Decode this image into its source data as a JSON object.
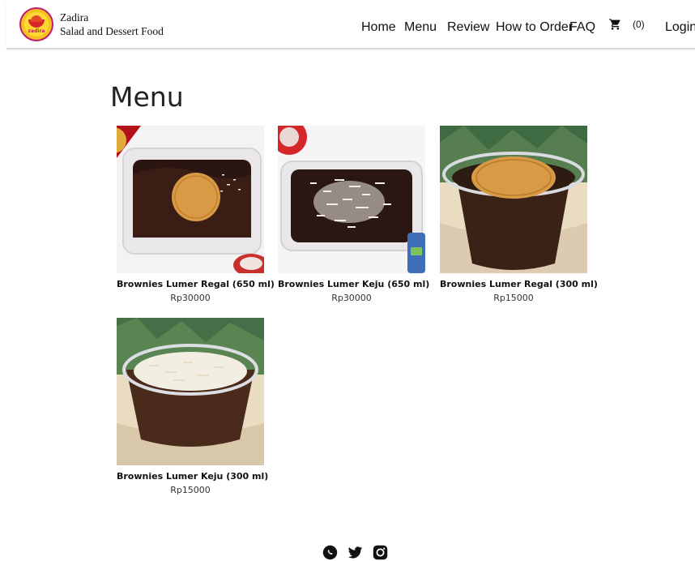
{
  "brand": {
    "name": "Zadira",
    "tagline": "Salad and Dessert Food",
    "logo_text": "zadira"
  },
  "nav": {
    "home": "Home",
    "menu": "Menu",
    "review": "Review",
    "how_to_order": "How to Order",
    "faq": "FAQ",
    "cart_count": "(0)",
    "login": "Login"
  },
  "page": {
    "title": "Menu"
  },
  "products": [
    {
      "name": "Brownies Lumer Regal (650 ml)",
      "price": "Rp30000"
    },
    {
      "name": "Brownies Lumer Keju (650 ml)",
      "price": "Rp30000"
    },
    {
      "name": "Brownies Lumer Regal (300 ml)",
      "price": "Rp15000"
    },
    {
      "name": "Brownies Lumer Keju (300 ml)",
      "price": "Rp15000"
    }
  ],
  "footer": {
    "icons": [
      "whatsapp-icon",
      "twitter-icon",
      "instagram-icon"
    ]
  },
  "colors": {
    "chocolate": "#2a1510",
    "biscuit": "#d99a45",
    "logo_yellow": "#ffd833",
    "logo_ring": "#c2187a"
  }
}
